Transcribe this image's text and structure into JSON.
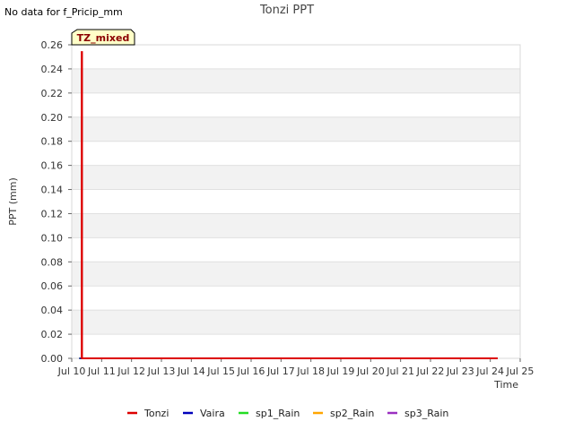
{
  "note": "No data for f_Pricip_mm",
  "badge": "TZ_mixed",
  "colors": {
    "Tonzi": "#dd0000",
    "Vaira": "#0000bb",
    "sp1_Rain": "#22dd22",
    "sp2_Rain": "#ffa500",
    "sp3_Rain": "#9a2fc0",
    "badge_fill": "#ffffc8",
    "band": "#f2f2f2",
    "grid": "#e0e0e0"
  },
  "chart_data": {
    "type": "line",
    "title": "Tonzi PPT",
    "xlabel": "Time",
    "ylabel": "PPT (mm)",
    "ylim": [
      0,
      0.26
    ],
    "yticks": [
      "0.00",
      "0.02",
      "0.04",
      "0.06",
      "0.08",
      "0.10",
      "0.12",
      "0.14",
      "0.16",
      "0.18",
      "0.20",
      "0.22",
      "0.24",
      "0.26"
    ],
    "xlim": [
      "2024-07-10",
      "2024-07-25"
    ],
    "xticks": [
      "Jul 10",
      "Jul 11",
      "Jul 12",
      "Jul 13",
      "Jul 14",
      "Jul 15",
      "Jul 16",
      "Jul 17",
      "Jul 18",
      "Jul 19",
      "Jul 20",
      "Jul 21",
      "Jul 22",
      "Jul 23",
      "Jul 24",
      "Jul 25"
    ],
    "grid": true,
    "legend_position": "bottom",
    "series": [
      {
        "name": "Tonzi",
        "x": [
          "2024-07-10 08:00",
          "2024-07-10 08:00",
          "2024-07-10 08:15",
          "2024-07-10 08:15",
          "2024-07-24 06:00"
        ],
        "y": [
          0,
          0.254,
          0.254,
          0,
          0
        ]
      },
      {
        "name": "Vaira",
        "x": [
          "2024-07-10 06:00",
          "2024-07-24 06:00"
        ],
        "y": [
          0,
          0
        ]
      },
      {
        "name": "sp1_Rain",
        "x": [
          "2024-07-10 06:00",
          "2024-07-24 06:00"
        ],
        "y": [
          0,
          0
        ]
      },
      {
        "name": "sp2_Rain",
        "x": [
          "2024-07-10 06:00",
          "2024-07-24 06:00"
        ],
        "y": [
          0,
          0
        ]
      },
      {
        "name": "sp3_Rain",
        "x": [
          "2024-07-10 06:00",
          "2024-07-24 06:00"
        ],
        "y": [
          0,
          0
        ]
      }
    ]
  }
}
